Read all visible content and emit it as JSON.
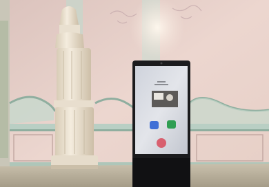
{
  "scene": {
    "description_colors": {
      "wall": "#ebd3cc",
      "wall_shadow": "#d9bdb5",
      "molding": "#b9cfc4",
      "molding_dark": "#8fae9f",
      "stove": "#efe6d6",
      "stove_shadow": "#cfc3ad",
      "floor": "#b7ae9a",
      "kiosk_frame": "#1b1b1d",
      "screen_glow": "#d9dde6",
      "app_blue": "#3f6fd6",
      "app_green": "#2f9e52",
      "app_red": "#d84a5a"
    }
  }
}
